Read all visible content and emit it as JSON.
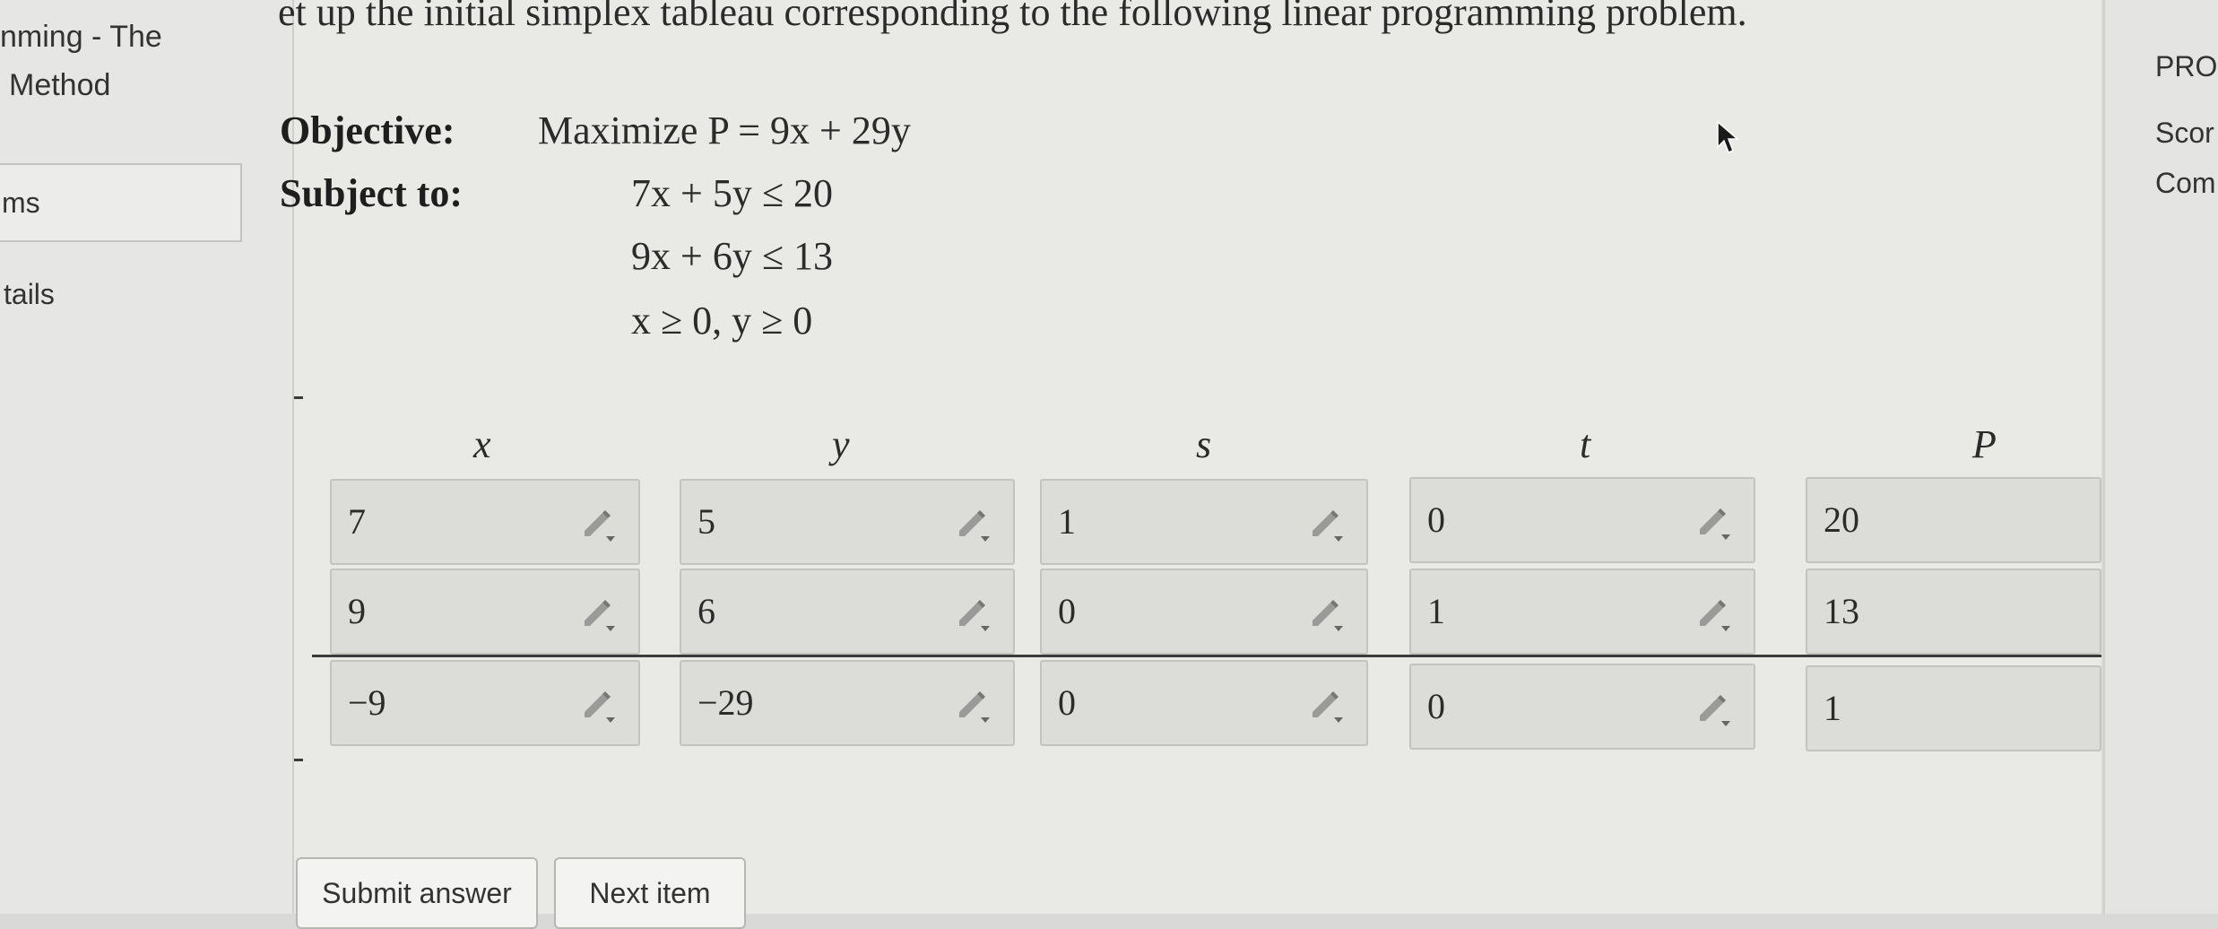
{
  "sidebar": {
    "title_line1": "nming - The",
    "title_line2": "Method",
    "items_label": "ms",
    "details_label": "tails"
  },
  "problem": {
    "instructions": "et up the initial simplex tableau corresponding to the following linear programming problem.",
    "objective_label": "Objective:",
    "objective_text": "Maximize P = 9x + 29y",
    "subject_label": "Subject to:",
    "constraints": [
      "7x + 5y ≤ 20",
      "9x + 6y ≤ 13",
      "x ≥ 0, y ≥ 0"
    ]
  },
  "tableau": {
    "columns": [
      "x",
      "y",
      "s",
      "t",
      "P"
    ],
    "rows": [
      [
        "7",
        "5",
        "1",
        "0",
        "20"
      ],
      [
        "9",
        "6",
        "0",
        "1",
        "13"
      ],
      [
        "−9",
        "−29",
        "0",
        "0",
        "1"
      ]
    ]
  },
  "buttons": {
    "submit": "Submit answer",
    "next": "Next item"
  },
  "right_panel": {
    "line1": "PRO",
    "line2": "Scor",
    "line3": "Com"
  },
  "icons": {
    "cell_edit": "pencil-dropdown-icon",
    "cursor": "mouse-pointer-icon"
  },
  "colors": {
    "cell_bg": "#dcdcd9",
    "page_bg": "#e9e9e6",
    "text": "#2b2b2b"
  }
}
